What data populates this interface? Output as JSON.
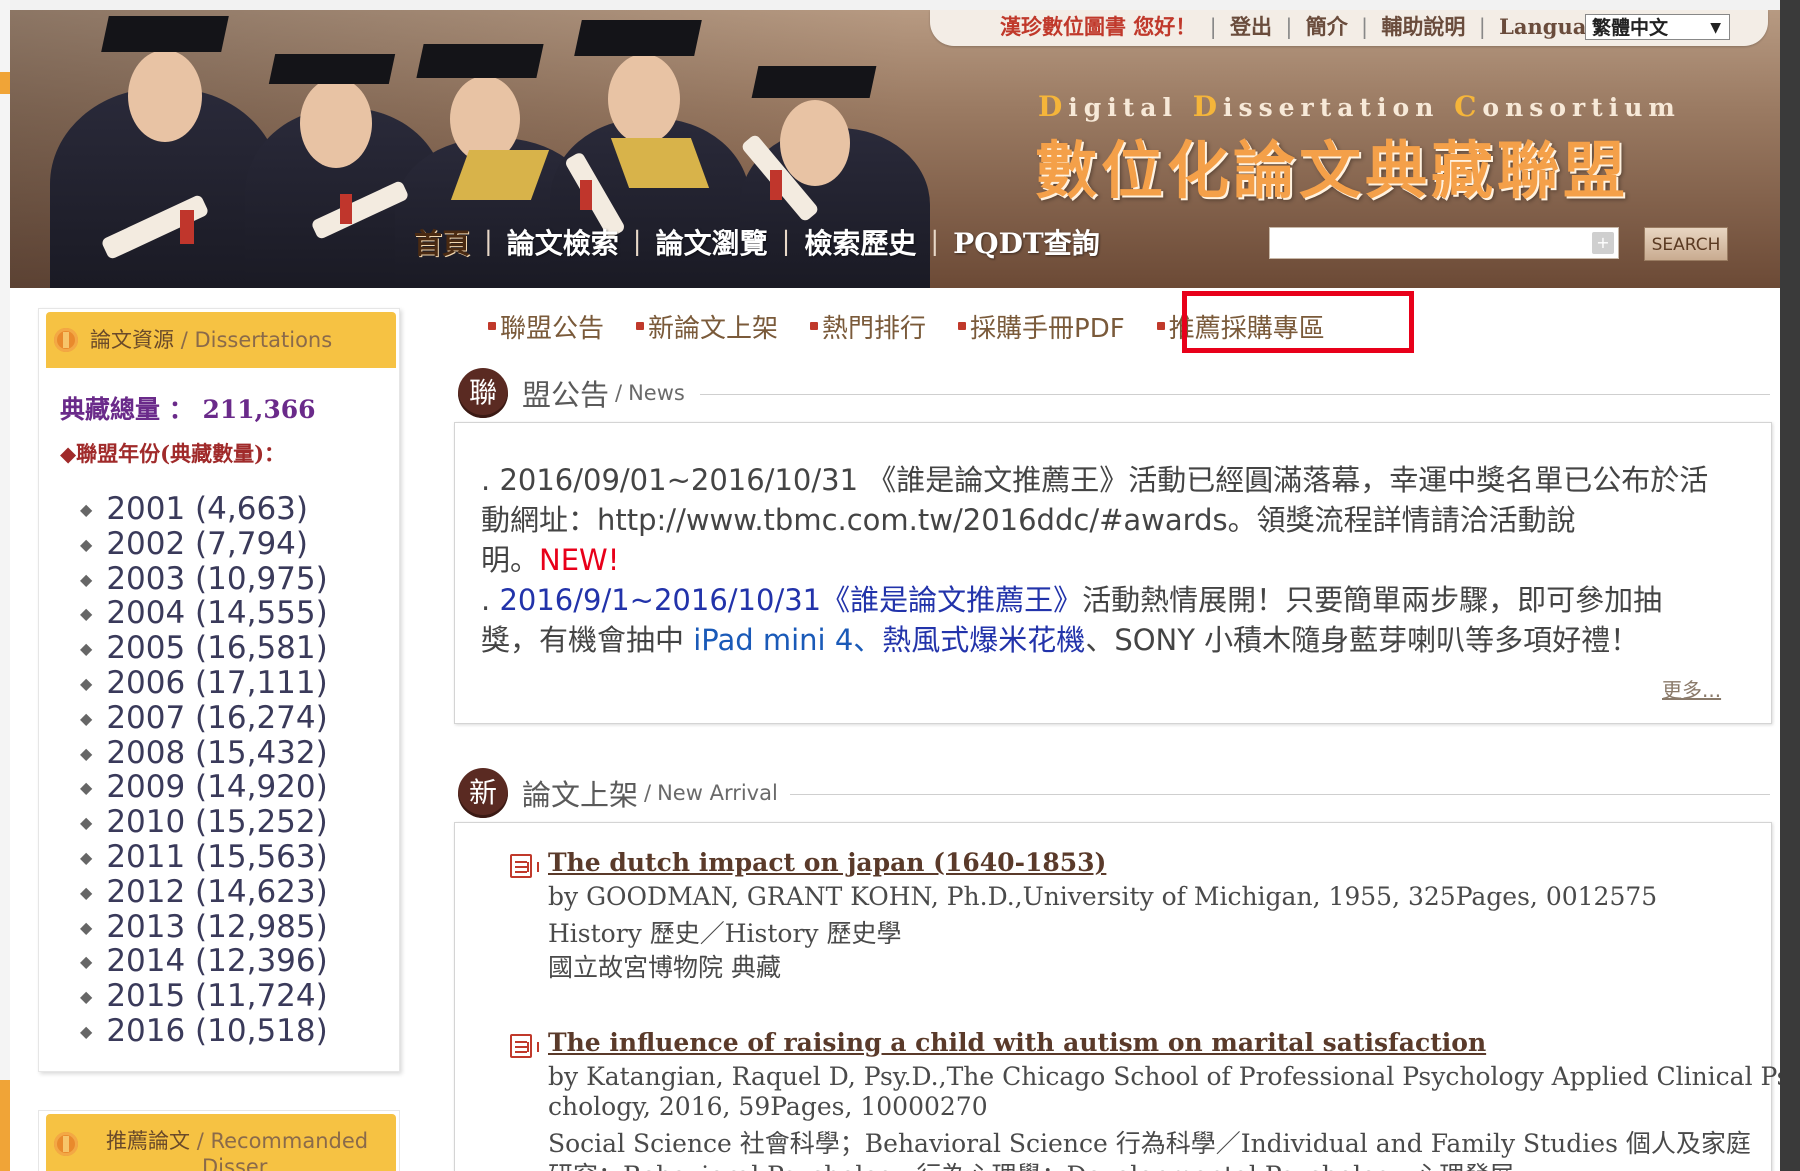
{
  "header": {
    "welcome": "漢珍數位圖書 您好！",
    "links": [
      "登出",
      "簡介",
      "輔助說明",
      "Language"
    ],
    "language_value": "繁體中文",
    "brand_en_words": [
      "Digital",
      "Dissertation",
      "Consortium"
    ],
    "brand_cn": "數位化論文典藏聯盟",
    "nav": [
      "首頁",
      "論文檢索",
      "論文瀏覽",
      "檢索歷史",
      "PQDT查詢"
    ],
    "search_placeholder": "",
    "search_button": "SEARCH"
  },
  "subnav": [
    "聯盟公告",
    "新論文上架",
    "熱門排行",
    "採購手冊PDF",
    "推薦採購專區"
  ],
  "sidebar": {
    "title_cn": "論文資源",
    "title_en": "Dissertations",
    "total_label": "典藏總量",
    "total_value": "211,366",
    "year_heading": "聯盟年份(典藏數量)：",
    "years": [
      "2001 (4,663)",
      "2002 (7,794)",
      "2003 (10,975)",
      "2004 (14,555)",
      "2005 (16,581)",
      "2006 (17,111)",
      "2007 (16,274)",
      "2008 (15,432)",
      "2009 (14,920)",
      "2010 (15,252)",
      "2011 (15,563)",
      "2012 (14,623)",
      "2013 (12,985)",
      "2014 (12,396)",
      "2015 (11,724)",
      "2016 (10,518)"
    ],
    "recommend_cn": "推薦論文",
    "recommend_en_1": "Recommanded",
    "recommend_en_2": "Disser."
  },
  "news": {
    "badge": "聯",
    "title_cn": "盟公告",
    "title_en": "News",
    "item1_line1": "2016/09/01~2016/10/31 《誰是論文推薦王》活動已經圓滿落幕，幸運中獎名單已公布於活",
    "item1_line2": "動網址：http://www.tbmc.com.tw/2016ddc/#awards。領獎流程詳情請洽活動說",
    "item1_line3": "明。",
    "item1_new": "NEW!",
    "item2_link": "2016/9/1~2016/10/31《誰是論文推薦王》",
    "item2_text": "活動熱情展開！只要簡單兩步驟，即可參加抽",
    "item2_line2_a": "獎，有機會抽中 ",
    "item2_ipad": "iPad mini 4",
    "item2_sep": "、",
    "item2_popcorn": "熱風式爆米花機",
    "item2_line2_b": "、SONY 小積木隨身藍芽喇叭等多項好禮！",
    "more": "更多..."
  },
  "arrivals": {
    "badge": "新",
    "title_cn": "論文上架",
    "title_en": "New Arrival",
    "items": [
      {
        "title": "The dutch impact on japan (1640-1853)",
        "byline": "by GOODMAN, GRANT KOHN, Ph.D.,University of Michigan, 1955, 325Pages, 0012575",
        "subject": "History 歷史／History 歷史學",
        "holder": "國立故宮博物院 典藏"
      },
      {
        "title": "The influence of raising a child with autism on marital satisfaction",
        "byline": "by Katangian, Raquel D, Psy.D.,The Chicago School of Professional Psychology Applied Clinical Psy",
        "byline2": "chology, 2016, 59Pages, 10000270",
        "subject": "Social Science 社會科學；Behavioral Science 行為科學／Individual and Family Studies 個人及家庭",
        "subject2": "研究；Behavioral Psychology 行為心理學；Developmental Psychology 心理發展"
      }
    ]
  }
}
